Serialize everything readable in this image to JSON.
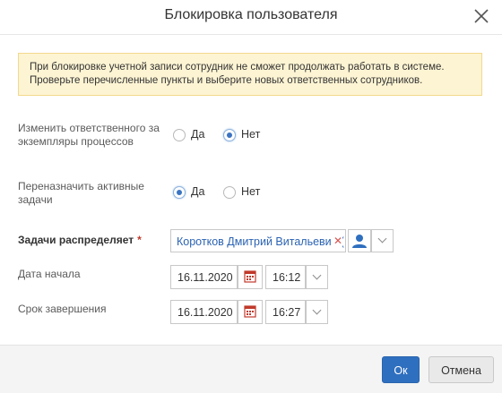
{
  "dialog": {
    "title": "Блокировка пользователя"
  },
  "notice": {
    "line1": "При блокировке учетной записи сотрудник не сможет продолжать работать в системе.",
    "line2": "Проверьте перечисленные пункты и выберите новых ответственных сотрудников."
  },
  "change_responsible": {
    "label_line1": "Изменить ответственного за",
    "label_line2": "экземпляры процессов",
    "yes": "Да",
    "no": "Нет",
    "selected": "no"
  },
  "reassign_tasks": {
    "label_line1": "Переназначить активные",
    "label_line2": "задачи",
    "yes": "Да",
    "no": "Нет",
    "selected": "yes"
  },
  "distributor": {
    "label": "Задачи распределяет",
    "required_mark": "*",
    "value": "Коротков Дмитрий Витальевич (",
    "remove_icon": "close-x-icon",
    "picker_icon": "user-icon"
  },
  "start": {
    "label": "Дата начала",
    "date": "16.11.2020",
    "time": "16:12"
  },
  "end": {
    "label": "Срок завершения",
    "date": "16.11.2020",
    "time": "16:27"
  },
  "footer": {
    "ok": "Ок",
    "cancel": "Отмена"
  },
  "colors": {
    "primary": "#2f6fbf",
    "notice_bg": "#fdf4d3",
    "link": "#2b63b3",
    "required": "#c0392b"
  }
}
